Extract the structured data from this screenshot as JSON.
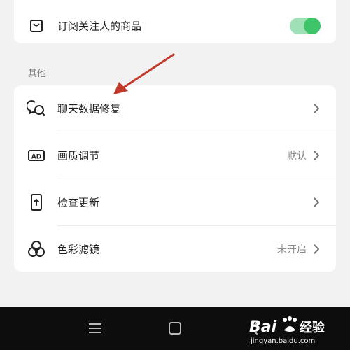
{
  "subscription_row": {
    "label": "订阅关注人的商品",
    "toggle_on": true
  },
  "section_other": {
    "label": "其他"
  },
  "items": [
    {
      "label": "聊天数据修复",
      "value": ""
    },
    {
      "label": "画质调节",
      "value": "默认"
    },
    {
      "label": "检查更新",
      "value": ""
    },
    {
      "label": "色彩滤镜",
      "value": "未开启"
    }
  ],
  "icons": {
    "subscription": "shopping-bag-icon",
    "chat_repair": "chat-bubbles-icon",
    "image_quality": "ad-badge-icon",
    "check_update": "phone-upload-icon",
    "color_filter": "three-circles-icon"
  },
  "colors": {
    "toggle_track": "#9fe0b6",
    "toggle_knob": "#3fc46a",
    "annotation_arrow": "#c0392b"
  },
  "watermark": {
    "brand": "Bai",
    "brand2": "经验",
    "url": "jingyan.baidu.com"
  }
}
